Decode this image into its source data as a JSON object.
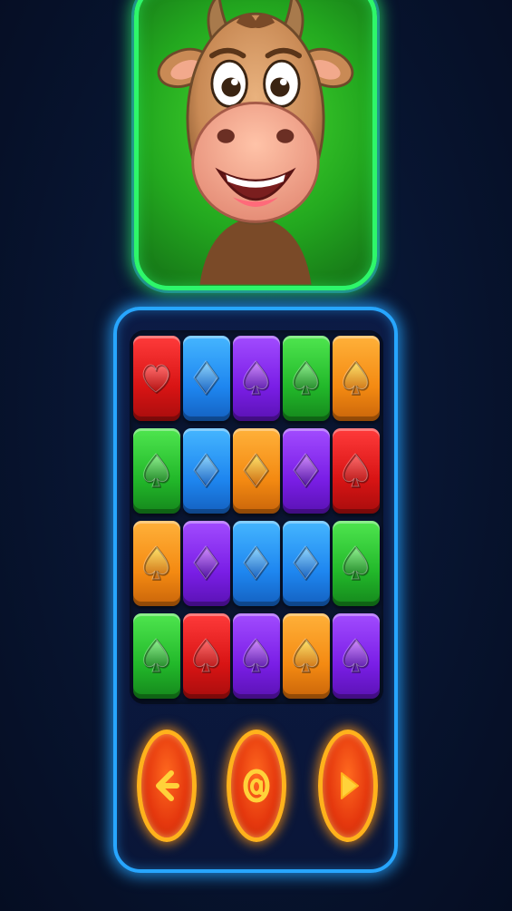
{
  "game": {
    "character": "cow",
    "colors": {
      "portrait_border": "#2ef76a",
      "board_border": "#27a6ff",
      "button_border": "#ffb21c"
    }
  },
  "board": {
    "rows": 4,
    "columns": 5,
    "tiles": [
      [
        {
          "color": "red",
          "symbol": "heart"
        },
        {
          "color": "blue",
          "symbol": "diamond"
        },
        {
          "color": "purple",
          "symbol": "spade"
        },
        {
          "color": "green",
          "symbol": "spade"
        },
        {
          "color": "orange",
          "symbol": "spade"
        }
      ],
      [
        {
          "color": "green",
          "symbol": "spade"
        },
        {
          "color": "blue",
          "symbol": "diamond"
        },
        {
          "color": "orange",
          "symbol": "diamond"
        },
        {
          "color": "purple",
          "symbol": "diamond"
        },
        {
          "color": "red",
          "symbol": "spade"
        }
      ],
      [
        {
          "color": "orange",
          "symbol": "spade"
        },
        {
          "color": "purple",
          "symbol": "diamond"
        },
        {
          "color": "blue",
          "symbol": "diamond"
        },
        {
          "color": "blue",
          "symbol": "diamond"
        },
        {
          "color": "green",
          "symbol": "spade"
        }
      ],
      [
        {
          "color": "green",
          "symbol": "spade"
        },
        {
          "color": "red",
          "symbol": "spade"
        },
        {
          "color": "purple",
          "symbol": "spade"
        },
        {
          "color": "orange",
          "symbol": "spade"
        },
        {
          "color": "purple",
          "symbol": "spade"
        }
      ]
    ]
  },
  "controls": [
    {
      "name": "back-button",
      "icon": "arrow-left-icon"
    },
    {
      "name": "center-button",
      "icon": "at-sign-icon"
    },
    {
      "name": "next-button",
      "icon": "play-icon"
    }
  ]
}
